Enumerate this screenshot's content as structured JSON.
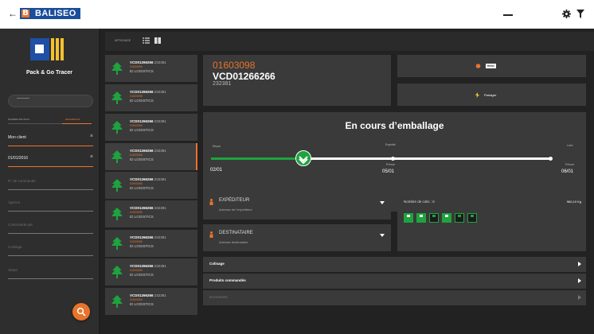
{
  "header": {
    "back_icon": "arrow-left",
    "logo_text": "BALISEO",
    "logo_mark": "B",
    "settings_icon": "gear-icon",
    "filter_icon": "filter-icon"
  },
  "sidebar": {
    "title": "Pack & Go Tracer",
    "sort_left": "NUMERO DE SUIVI",
    "sort_right": "REFERENCE",
    "fields": [
      {
        "value": "Mon client",
        "placeholder": ""
      },
      {
        "value": "01/01/2016",
        "placeholder": ""
      },
      {
        "value": "",
        "placeholder": "N° de commande"
      },
      {
        "value": "",
        "placeholder": "Agence"
      },
      {
        "value": "",
        "placeholder": "Commande par"
      },
      {
        "value": "",
        "placeholder": "Colisage"
      },
      {
        "value": "",
        "placeholder": "Statut"
      }
    ]
  },
  "toolbar": {
    "label": "AFFICHAGE"
  },
  "results": [
    {
      "ref": "VCD01266266",
      "num": "232381",
      "code": "01603098",
      "company": "ID LOGISTICS"
    },
    {
      "ref": "VCD01266266",
      "num": "232381",
      "code": "01603098",
      "company": "ID LOGISTICS"
    },
    {
      "ref": "VCD01266266",
      "num": "232381",
      "code": "01603098",
      "company": "ID LOGISTICS"
    },
    {
      "ref": "VCD01266266",
      "num": "232381",
      "code": "01603098",
      "company": "ID LOGISTICS"
    },
    {
      "ref": "VCD01266266",
      "num": "232381",
      "code": "01603098",
      "company": "ID LOGISTICS"
    },
    {
      "ref": "VCD01266266",
      "num": "232381",
      "code": "01603098",
      "company": "ID LOGISTICS"
    },
    {
      "ref": "VCD01266266",
      "num": "232381",
      "code": "01603098",
      "company": "ID LOGISTICS"
    },
    {
      "ref": "VCD01266266",
      "num": "232381",
      "code": "01603098",
      "company": "ID LOGISTICS"
    },
    {
      "ref": "VCD01266266",
      "num": "232381",
      "code": "01603098",
      "company": "ID LOGISTICS"
    }
  ],
  "detail": {
    "tracking_number": "01603098",
    "reference": "VCD01266266",
    "sub_number": "232381",
    "hello_label": "Hello!",
    "share_label": "Partager",
    "status_title": "En cours d’emballage",
    "steps": [
      {
        "label": "Reçue",
        "date": "02/01"
      },
      {
        "label": "Expédié",
        "date": ""
      },
      {
        "label": "Prévue",
        "date": "05/01"
      },
      {
        "label": "Livré",
        "date": ""
      },
      {
        "label": "Prévue",
        "date": "06/01"
      }
    ],
    "progress_fraction": 0.27,
    "expediteur_title": "EXPÉDITEUR",
    "expediteur_sub": "Adresse de l’expéditeur",
    "destinataire_title": "DESTINATAIRE",
    "destinataire_sub": "Adresse destinataire",
    "colis_label": "Nombre de colis : 6",
    "weight": "960,10 Kg",
    "packages_filled": [
      true,
      true,
      false,
      true,
      false,
      false
    ],
    "rows": [
      {
        "label": "Colisage",
        "dim": false
      },
      {
        "label": "Produits commandés",
        "dim": false
      },
      {
        "label": "Documents",
        "dim": true
      }
    ]
  },
  "colors": {
    "accent": "#e8742a",
    "brand_blue": "#1a4d9c",
    "success": "#1ea33e"
  }
}
